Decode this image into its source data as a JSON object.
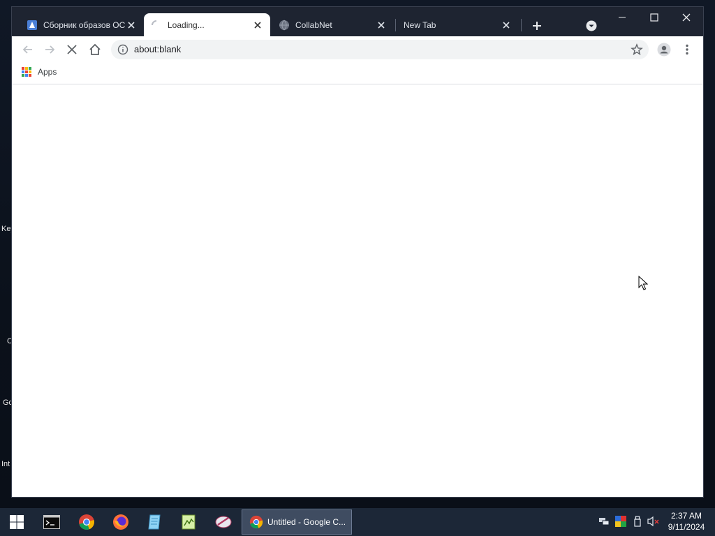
{
  "desktop": {
    "labels": [
      "Key",
      "C",
      "Go",
      "Int"
    ]
  },
  "browser": {
    "tabs": [
      {
        "title": "Сборник образов ОС",
        "favicon": "document-icon",
        "active": false
      },
      {
        "title": "Loading...",
        "favicon": "loading-spinner-icon",
        "active": true
      },
      {
        "title": "CollabNet",
        "favicon": "globe-icon",
        "active": false
      },
      {
        "title": "New Tab",
        "favicon": "",
        "active": false
      }
    ],
    "address": "about:blank",
    "bookmarks": {
      "apps_label": "Apps"
    },
    "window_controls": [
      "minimize-icon",
      "maximize-icon",
      "close-icon"
    ]
  },
  "taskbar": {
    "pinned": [
      "windows-start-icon",
      "terminal-icon",
      "chrome-icon",
      "firefox-icon",
      "notepad-icon",
      "editor-icon",
      "tool-icon"
    ],
    "active_app": {
      "label": "Untitled - Google C...",
      "icon": "chrome-icon"
    },
    "tray": [
      "network-icon",
      "color-icon",
      "usb-icon",
      "volume-muted-icon"
    ],
    "clock": {
      "time": "2:37 AM",
      "date": "9/11/2024"
    }
  },
  "colors": {
    "tabstrip": "#1e2431",
    "taskbar": "#1c2737",
    "accent": "#4285f4"
  }
}
